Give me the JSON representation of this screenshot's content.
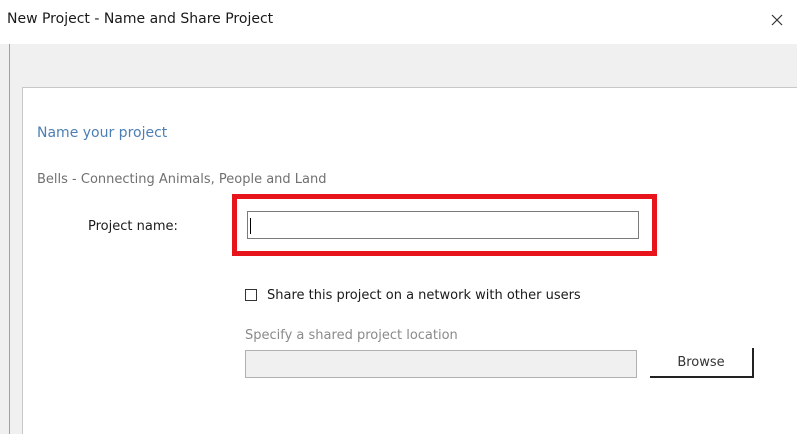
{
  "window": {
    "title": "New Project - Name and Share Project"
  },
  "page": {
    "heading": "Name your project",
    "subheading": "Bells - Connecting Animals, People and Land"
  },
  "form": {
    "project_name_label": "Project name:",
    "project_name_value": "",
    "share_checkbox_label": "Share this project on a network with other users",
    "share_checked": false,
    "shared_location_label": "Specify a shared project location",
    "shared_location_value": "",
    "browse_label": "Browse"
  },
  "colors": {
    "highlight": "#e8141b",
    "heading": "#4c7fb4"
  },
  "icons": {
    "close": "close-icon"
  }
}
